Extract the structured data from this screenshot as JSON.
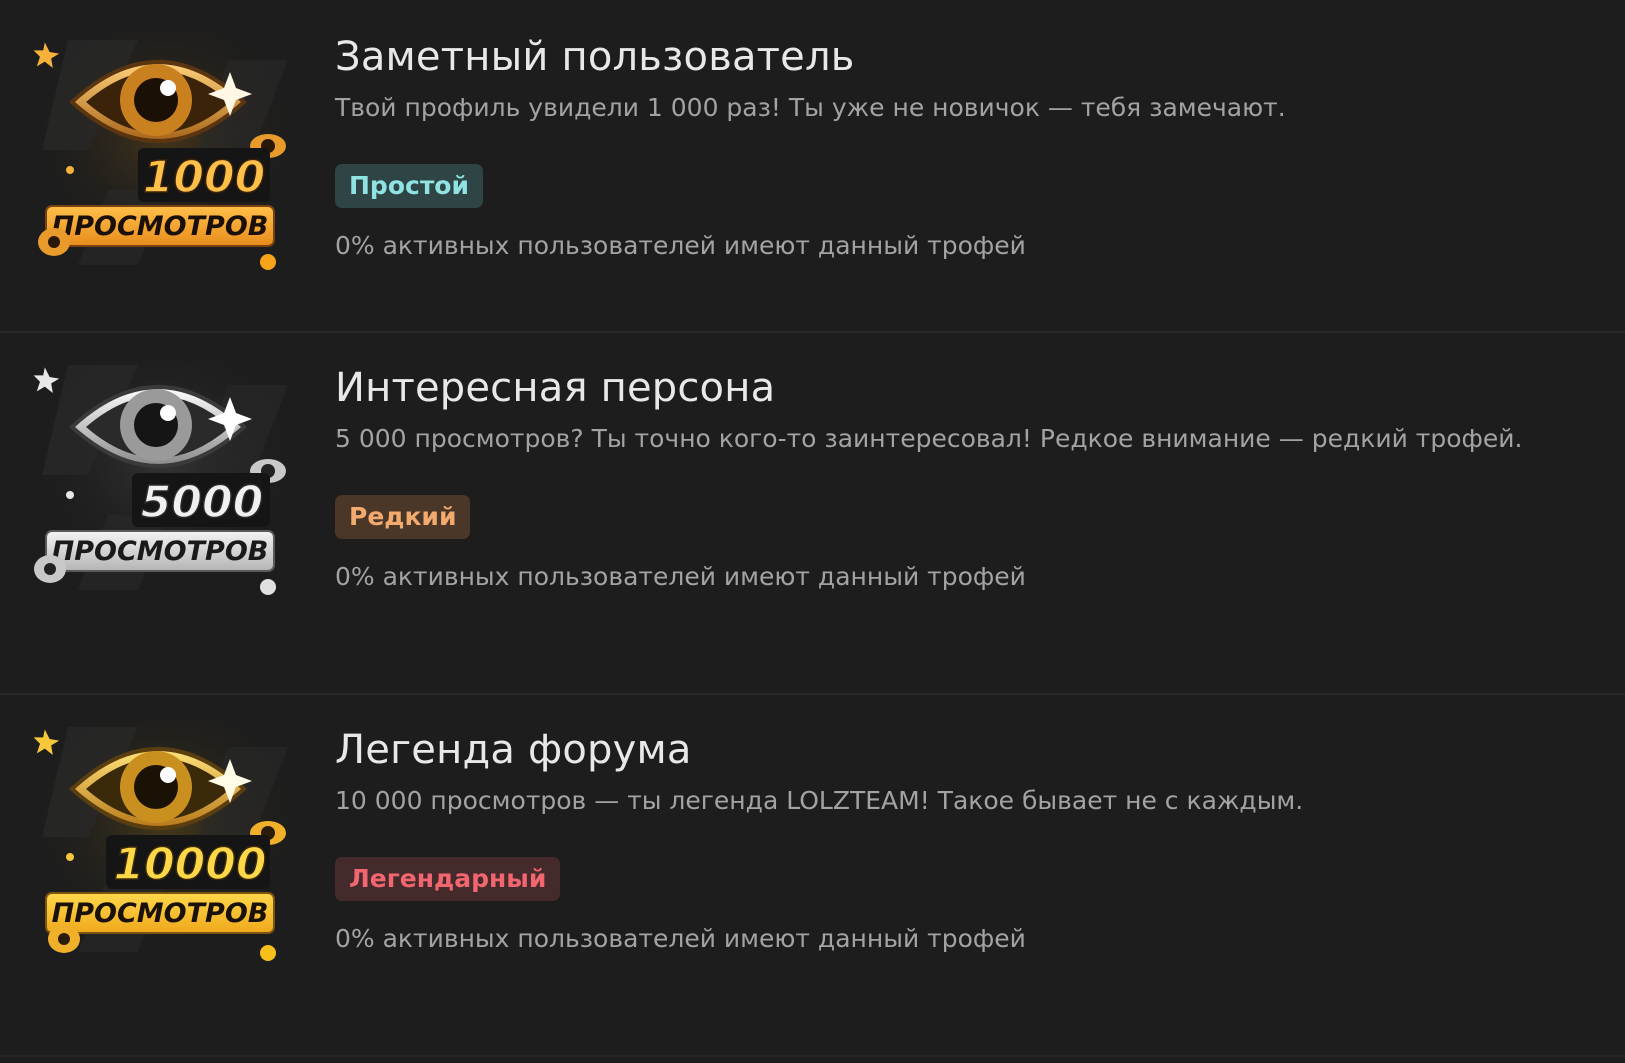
{
  "trophies": [
    {
      "title": "Заметный пользователь",
      "description": "Твой профиль увидели 1 000 раз! Ты уже не новичок — тебя замечают.",
      "rarity": "Простой",
      "percent_text": "0% активных пользователей имеют данный трофей",
      "badge": {
        "number": "1000",
        "word": "ПРОСМОТРОВ",
        "theme": "bronze"
      }
    },
    {
      "title": "Интересная персона",
      "description": "5 000 просмотров? Ты точно кого-то заинтересовал! Редкое внимание — редкий трофей.",
      "rarity": "Редкий",
      "percent_text": "0% активных пользователей имеют данный трофей",
      "badge": {
        "number": "5000",
        "word": "ПРОСМОТРОВ",
        "theme": "silver"
      }
    },
    {
      "title": "Легенда форума",
      "description": "10 000 просмотров — ты легенда LOLZTEAM! Такое бывает не с каждым.",
      "rarity": "Легендарный",
      "percent_text": "0% активных пользователей имеют данный трофей",
      "badge": {
        "number": "10000",
        "word": "ПРОСМОТРОВ",
        "theme": "gold"
      }
    }
  ],
  "colors": {
    "background": "#1d1d1d",
    "simple_badge_bg": "#2f4444",
    "simple_badge_text": "#8fe3e3",
    "rare_badge_bg": "#4a3727",
    "rare_badge_text": "#f2aa6e",
    "legendary_badge_bg": "#452a2c",
    "legendary_badge_text": "#f2666f"
  }
}
